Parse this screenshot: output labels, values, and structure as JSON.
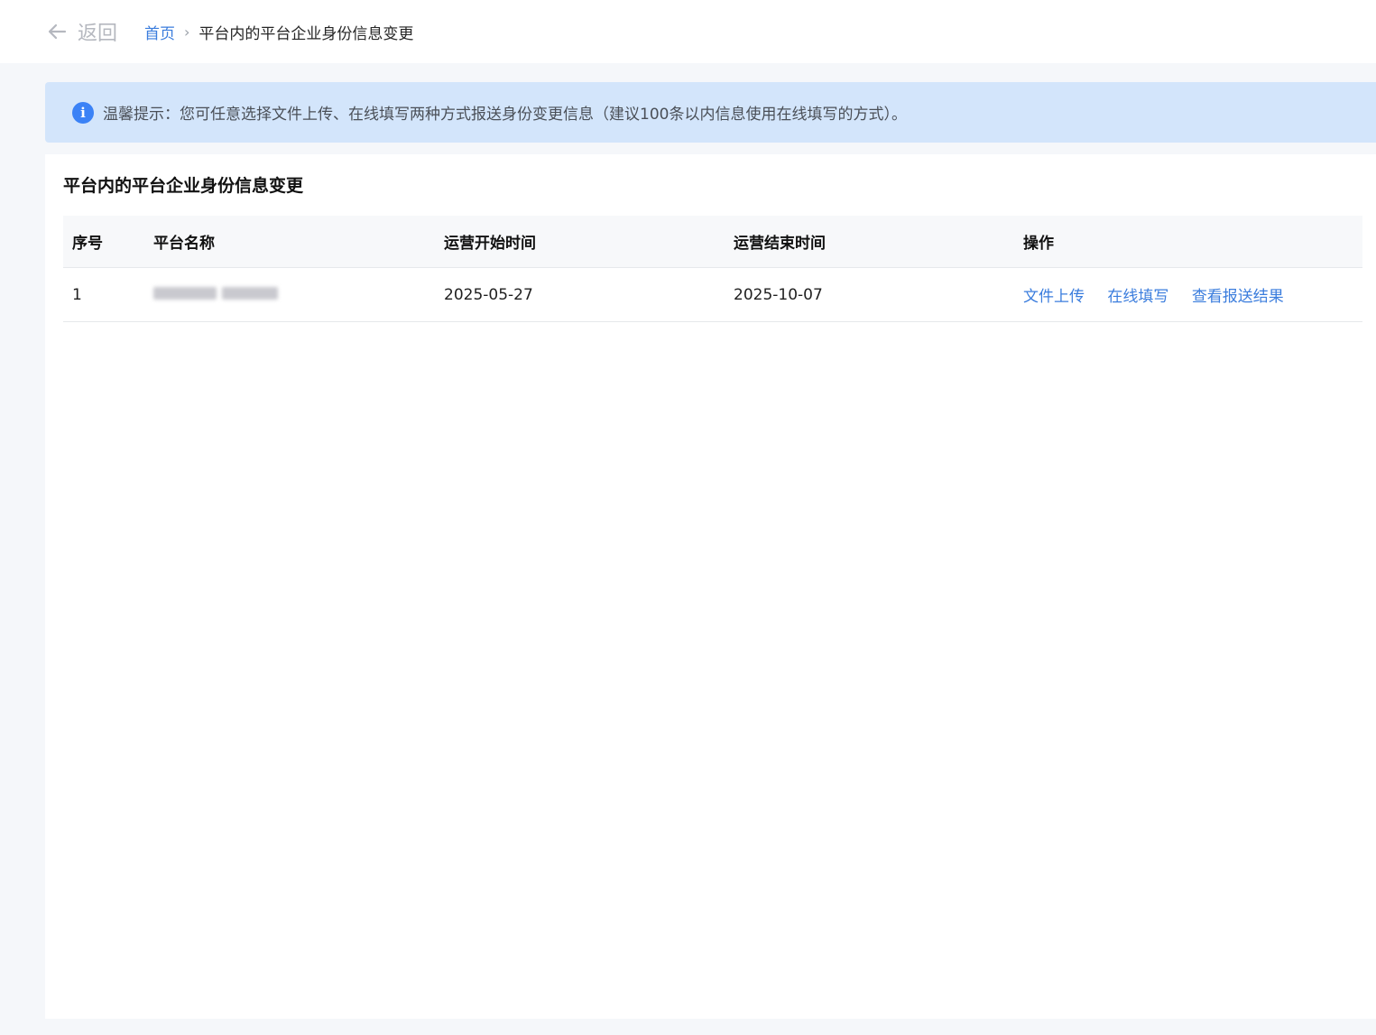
{
  "topbar": {
    "back_label": "返回",
    "breadcrumb": {
      "home": "首页",
      "separator": "›",
      "current": "平台内的平台企业身份信息变更"
    }
  },
  "notice": {
    "icon": "info-icon",
    "text": "温馨提示：您可任意选择文件上传、在线填写两种方式报送身份变更信息（建议100条以内信息使用在线填写的方式）。"
  },
  "card": {
    "title": "平台内的平台企业身份信息变更",
    "table": {
      "headers": [
        "序号",
        "平台名称",
        "运营开始时间",
        "运营结束时间",
        "操作"
      ],
      "rows": [
        {
          "index": "1",
          "platform_name": "",
          "start": "2025-05-27",
          "end": "2025-10-07",
          "actions": [
            "文件上传",
            "在线填写",
            "查看报送结果"
          ]
        }
      ]
    }
  },
  "colors": {
    "link": "#3b7ddd",
    "notice_bg": "#d3e5fb",
    "info_icon": "#3b82f6"
  }
}
